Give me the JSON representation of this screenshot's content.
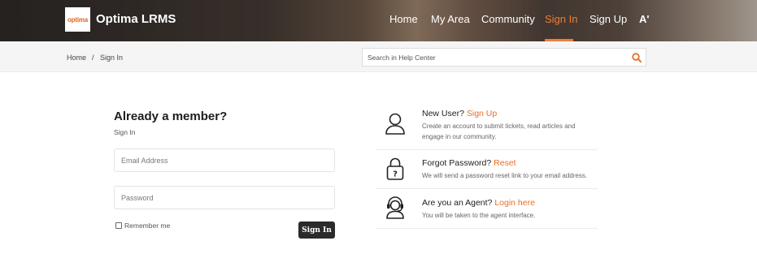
{
  "header": {
    "logo_text": "optima",
    "brand": "Optima LRMS",
    "nav": [
      "Home",
      "My Area",
      "Community",
      "Sign In",
      "Sign Up",
      "A'"
    ],
    "active_nav": "Sign In",
    "accent_color": "#f07d35"
  },
  "breadcrumb": {
    "home": "Home",
    "separator": "/",
    "current": "Sign In"
  },
  "search": {
    "placeholder": "Search in Help Center",
    "icon": "search-icon"
  },
  "login": {
    "title": "Already a member?",
    "subtitle": "Sign In",
    "email_placeholder": "Email Address",
    "password_placeholder": "Password",
    "remember_label": "Remember me",
    "remember_checked": false,
    "button_label": "Sign In"
  },
  "options": [
    {
      "icon": "user-icon",
      "prefix": "New User?",
      "link": "Sign Up",
      "desc": "Create an account to submit tickets, read articles and engage in our community."
    },
    {
      "icon": "lock-question-icon",
      "prefix": "Forgot Password?",
      "link": "Reset",
      "desc": "We will send a password reset link to your email address."
    },
    {
      "icon": "headset-agent-icon",
      "prefix": "Are you an Agent?",
      "link": "Login here",
      "desc": "You will be taken to the agent interface."
    }
  ]
}
